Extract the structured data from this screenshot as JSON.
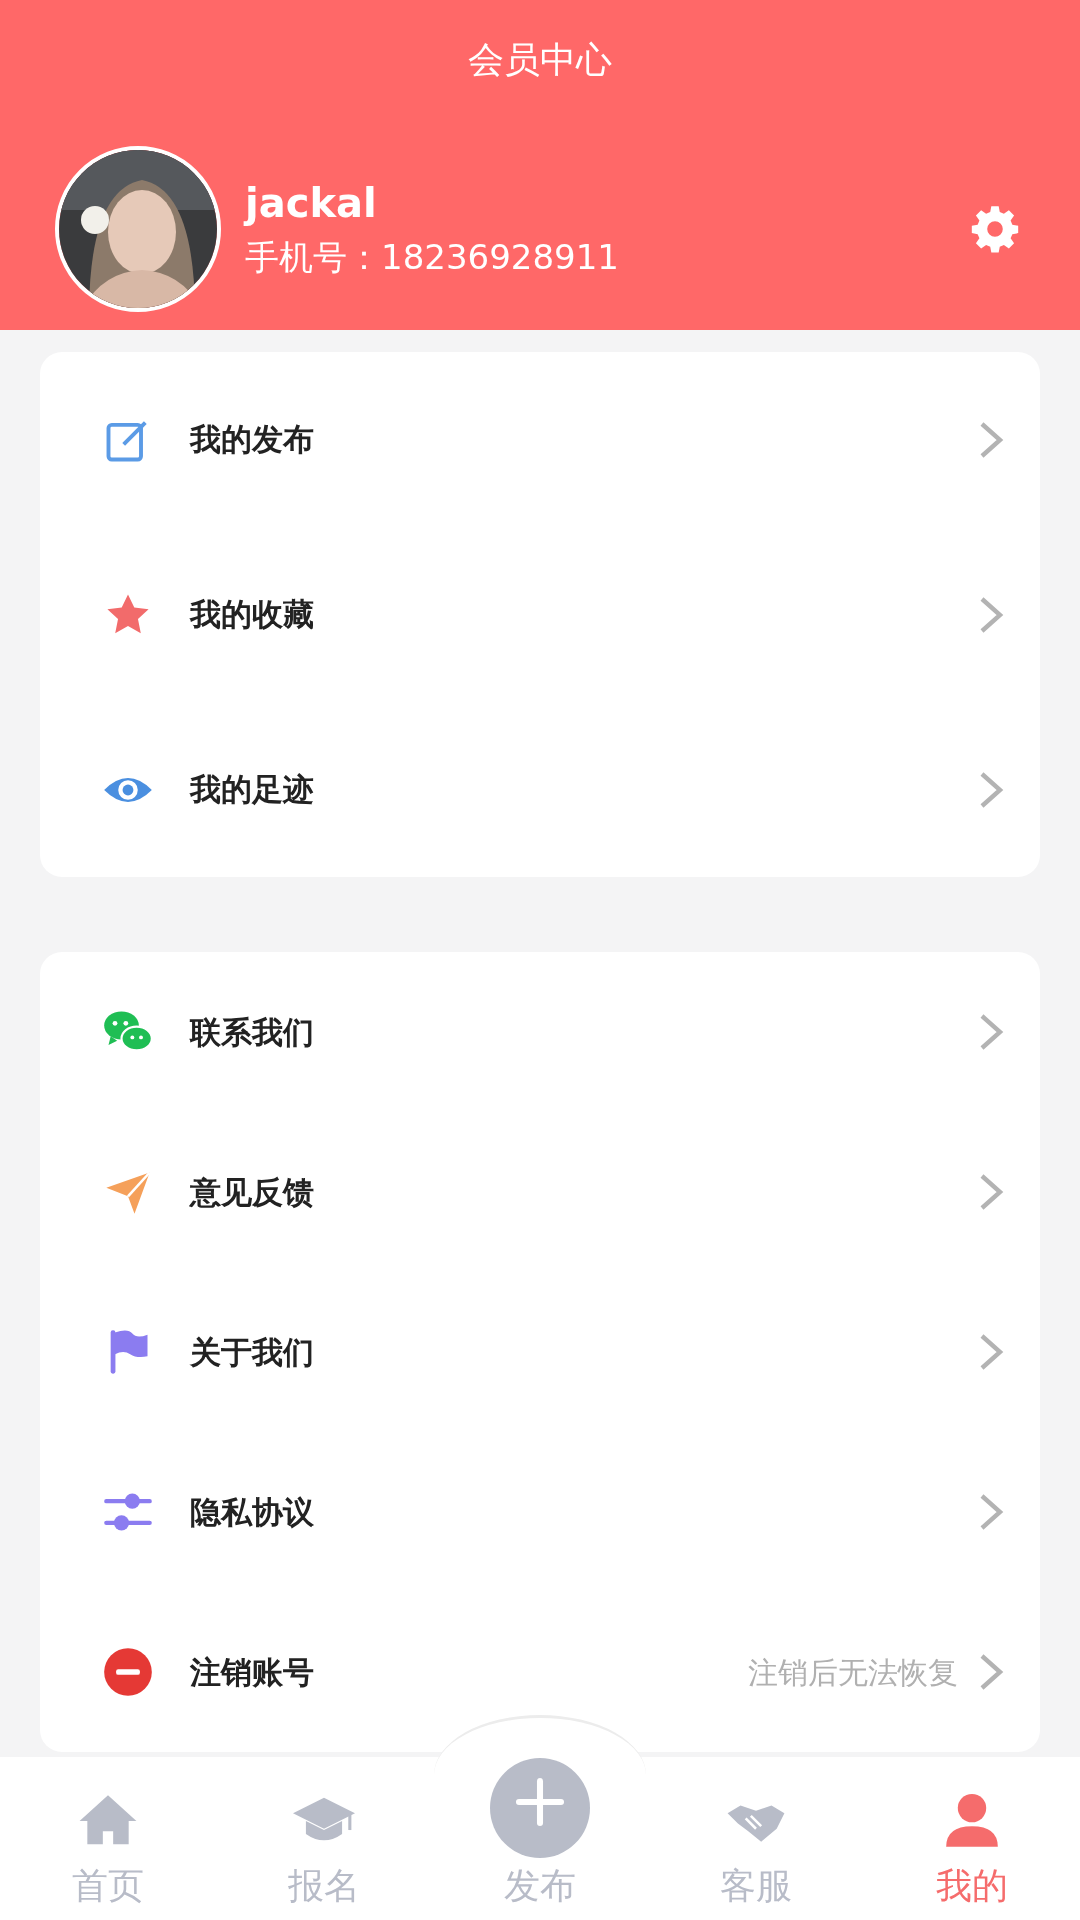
{
  "header": {
    "title": "会员中心",
    "user": {
      "name": "jackal",
      "phone": "手机号：18236928911"
    }
  },
  "menu_groups": [
    {
      "items": [
        {
          "label": "我的发布"
        },
        {
          "label": "我的收藏"
        },
        {
          "label": "我的足迹"
        }
      ]
    },
    {
      "items": [
        {
          "label": "联系我们"
        },
        {
          "label": "意见反馈"
        },
        {
          "label": "关于我们"
        },
        {
          "label": "隐私协议"
        },
        {
          "label": "注销账号",
          "note": "注销后无法恢复"
        }
      ]
    }
  ],
  "tab_bar": [
    {
      "label": "首页",
      "kind": "plain",
      "selected": false
    },
    {
      "label": "报名",
      "kind": "plain",
      "selected": false
    },
    {
      "label": "发布",
      "kind": "raised",
      "selected": false
    },
    {
      "label": "客服",
      "kind": "plain",
      "selected": false
    },
    {
      "label": "我的",
      "kind": "plain",
      "selected": true
    }
  ]
}
